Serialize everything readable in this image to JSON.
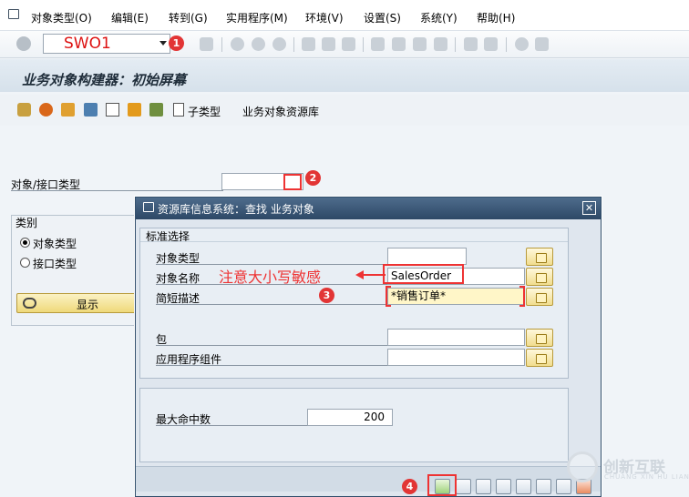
{
  "menu": {
    "items": [
      "对象类型(O)",
      "编辑(E)",
      "转到(G)",
      "实用程序(M)",
      "环境(V)",
      "设置(S)",
      "系统(Y)",
      "帮助(H)"
    ]
  },
  "toolbar": {
    "command_value": "SWO1"
  },
  "annotations": {
    "badge1": "1",
    "badge2": "2",
    "badge3": "3",
    "badge4": "4",
    "note": "注意大小写敏感"
  },
  "page": {
    "title": "业务对象构建器：初始屏幕",
    "app_toolbar": {
      "subtype_label": "子类型",
      "repository_label": "业务对象资源库"
    },
    "object_type_label": "对象/接口类型",
    "category": {
      "title": "类别",
      "options": [
        "对象类型",
        "接口类型"
      ],
      "selected": "对象类型"
    },
    "display_button": "显示"
  },
  "dialog": {
    "title": "资源库信息系统：查找 业务对象",
    "group1_title": "标准选择",
    "fields": {
      "object_type": {
        "label": "对象类型",
        "value": ""
      },
      "object_name": {
        "label": "对象名称",
        "value": "SalesOrder"
      },
      "short_desc": {
        "label": "简短描述",
        "value": "*销售订单*"
      },
      "package": {
        "label": "包",
        "value": ""
      },
      "app_component": {
        "label": "应用程序组件",
        "value": ""
      }
    },
    "max_hits_label": "最大命中数",
    "max_hits_value": "200"
  },
  "watermark": {
    "text": "创新互联",
    "sub": "CHUANG XIN HU LIAN"
  },
  "colors": {
    "accent_red": "#e33333",
    "dialog_header": "#2d4866",
    "button_yellow": "#efd97a"
  }
}
